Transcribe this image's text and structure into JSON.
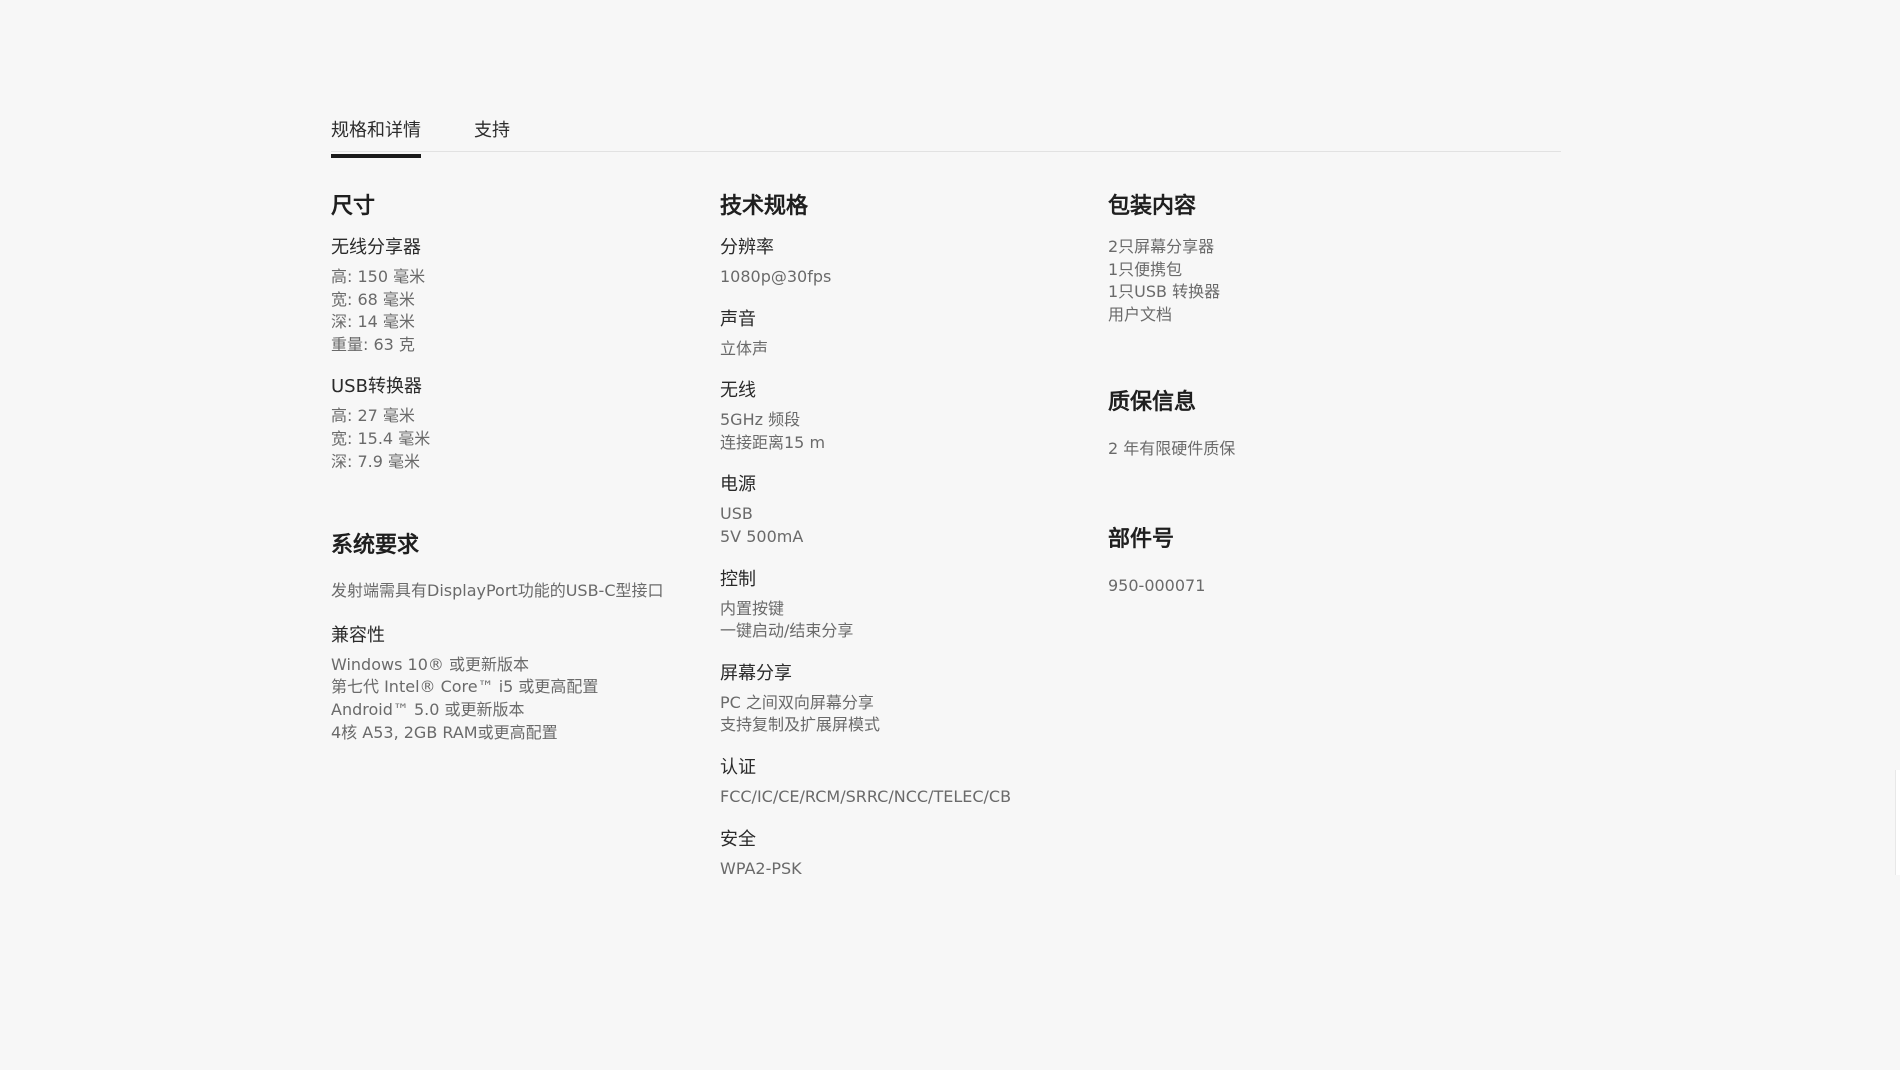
{
  "tabs": [
    {
      "label": "规格和详情",
      "active": true
    },
    {
      "label": "支持",
      "active": false
    }
  ],
  "columns": {
    "col1": {
      "dimensions": {
        "title": "尺寸",
        "groups": [
          {
            "title": "无线分享器",
            "lines": [
              "高: 150 毫米",
              "宽: 68 毫米",
              "深: 14 毫米",
              "重量: 63 克"
            ]
          },
          {
            "title": "USB转换器",
            "lines": [
              "高: 27 毫米",
              "宽: 15.4 毫米",
              "深: 7.9 毫米"
            ]
          }
        ]
      },
      "system": {
        "title": "系统要求",
        "groups": [
          {
            "title": "",
            "lines": [
              "发射端需具有DisplayPort功能的USB-C型接口"
            ]
          },
          {
            "title": "兼容性",
            "lines": [
              "Windows 10® 或更新版本",
              "第七代 Intel® Core™ i5 或更高配置",
              "Android™ 5.0 或更新版本",
              "4核 A53, 2GB RAM或更高配置"
            ]
          }
        ]
      }
    },
    "col2": {
      "title": "技术规格",
      "groups": [
        {
          "title": "分辨率",
          "lines": [
            "1080p@30fps"
          ]
        },
        {
          "title": "声音",
          "lines": [
            "立体声"
          ]
        },
        {
          "title": "无线",
          "lines": [
            "5GHz 频段",
            "连接距离15 m"
          ]
        },
        {
          "title": "电源",
          "lines": [
            "USB",
            "5V 500mA"
          ]
        },
        {
          "title": "控制",
          "lines": [
            "内置按键",
            "一键启动/结束分享"
          ]
        },
        {
          "title": "屏幕分享",
          "lines": [
            "PC 之间双向屏幕分享",
            "支持复制及扩展屏模式"
          ]
        },
        {
          "title": "认证",
          "lines": [
            "FCC/IC/CE/RCM/SRRC/NCC/TELEC/CB"
          ]
        },
        {
          "title": "安全",
          "lines": [
            "WPA2-PSK"
          ]
        }
      ]
    },
    "col3": {
      "package": {
        "title": "包装内容",
        "lines": [
          "2只屏幕分享器",
          "1只便携包",
          "1只USB 转换器",
          "用户文档"
        ]
      },
      "warranty": {
        "title": "质保信息",
        "lines": [
          "2 年有限硬件质保"
        ]
      },
      "part": {
        "title": "部件号",
        "lines": [
          "950-000071"
        ]
      }
    }
  }
}
